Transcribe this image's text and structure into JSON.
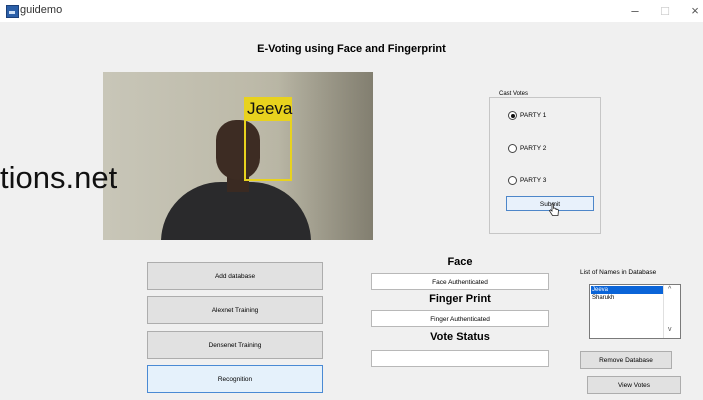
{
  "window": {
    "title": "guidemo",
    "minimize": "–",
    "maximize": "□",
    "close": "×"
  },
  "page_title": "E-Voting using Face and Fingerprint",
  "camera": {
    "face_label": "Jeeva",
    "watermark": "tions.net"
  },
  "cast_votes": {
    "label": "Cast Votes",
    "options": [
      {
        "label": "PARTY 1",
        "selected": true
      },
      {
        "label": "PARTY 2",
        "selected": false
      },
      {
        "label": "PARTY 3",
        "selected": false
      }
    ],
    "submit": "Submit"
  },
  "left_buttons": {
    "add_database": "Add database",
    "alexnet": "Alexnet Training",
    "densenet": "Densenet Training",
    "recognition": "Recognition"
  },
  "status": {
    "face_heading": "Face",
    "face_value": "Face Authenticated",
    "finger_heading": "Finger Print",
    "finger_value": "Finger Authenticated",
    "vote_heading": "Vote Status",
    "vote_value": ""
  },
  "database": {
    "list_label": "List of Names  in Database",
    "names": [
      "Jeeva",
      "Sharukh"
    ],
    "selected_index": 0,
    "remove_button": "Remove Database",
    "view_button": "View Votes"
  },
  "colors": {
    "selection": "#0a64d8",
    "face_box": "#e8d21e",
    "focus_border": "#4a8ad4"
  }
}
